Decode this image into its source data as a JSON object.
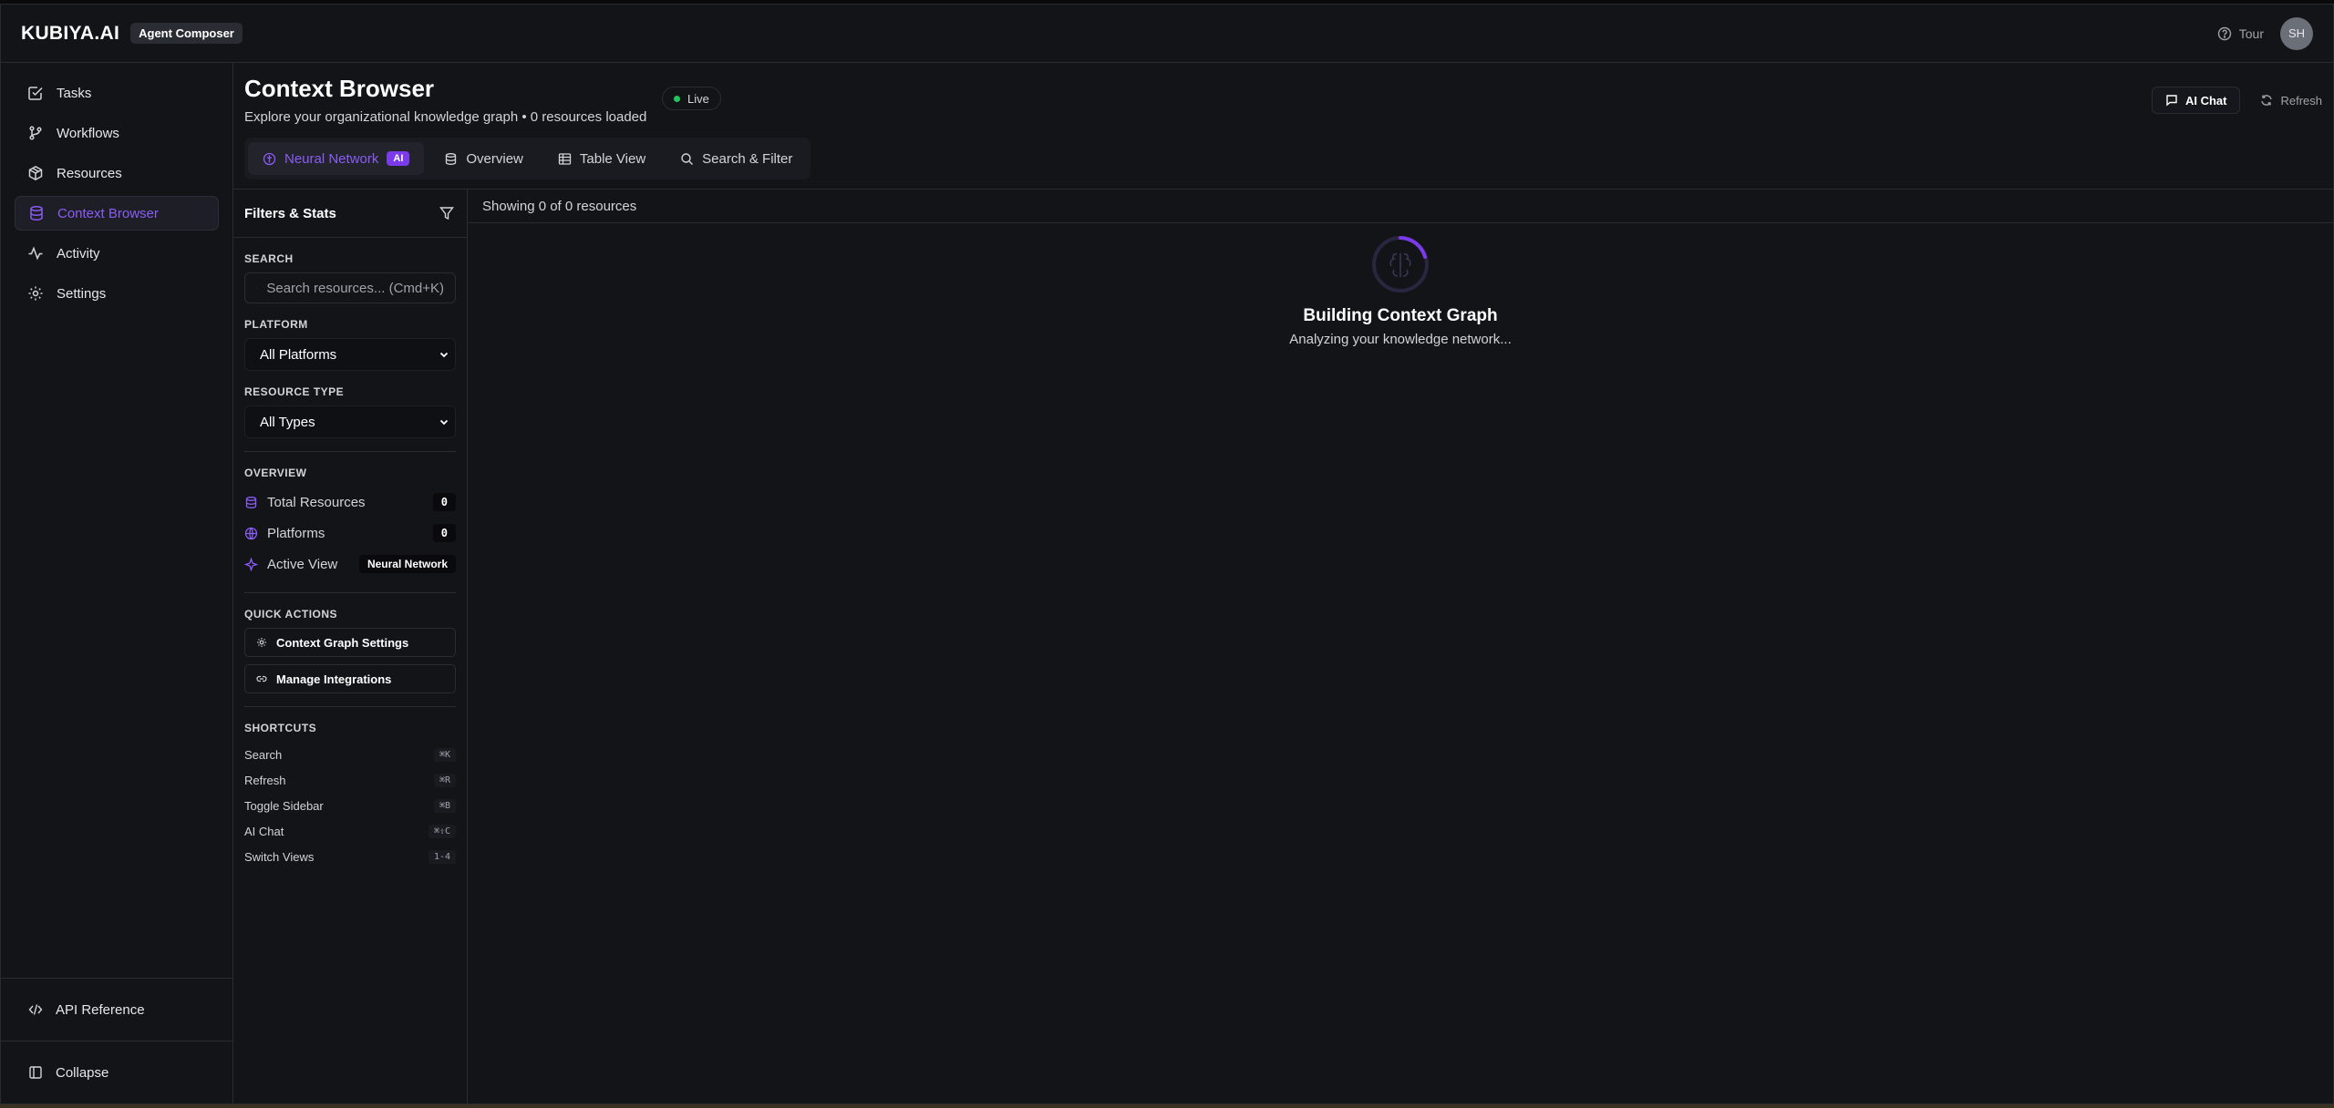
{
  "app": {
    "logo": "KUBIYA.AI",
    "tag": "Agent Composer"
  },
  "topbar": {
    "tour_label": "Tour",
    "avatar_initials": "SH"
  },
  "sidebar": {
    "items": [
      {
        "label": "Tasks",
        "icon": "task-check-icon"
      },
      {
        "label": "Workflows",
        "icon": "workflow-branch-icon"
      },
      {
        "label": "Resources",
        "icon": "box-icon"
      },
      {
        "label": "Context Browser",
        "icon": "database-icon",
        "active": true
      },
      {
        "label": "Activity",
        "icon": "activity-pulse-icon"
      },
      {
        "label": "Settings",
        "icon": "gear-icon"
      }
    ],
    "api_reference": "API Reference",
    "collapse": "Collapse"
  },
  "header": {
    "title": "Context Browser",
    "subtitle": "Explore your organizational knowledge graph • 0 resources loaded",
    "live": "Live",
    "ai_chat": "AI Chat",
    "refresh": "Refresh"
  },
  "tabs": [
    {
      "label": "Neural Network",
      "badge": "AI",
      "active": true
    },
    {
      "label": "Overview"
    },
    {
      "label": "Table View"
    },
    {
      "label": "Search & Filter"
    }
  ],
  "filters": {
    "heading": "Filters & Stats",
    "search_label": "SEARCH",
    "search_placeholder": "Search resources... (Cmd+K)",
    "platform_label": "PLATFORM",
    "platform_value": "All Platforms",
    "type_label": "RESOURCE TYPE",
    "type_value": "All Types",
    "overview_label": "OVERVIEW",
    "overview": [
      {
        "label": "Total Resources",
        "value": "0"
      },
      {
        "label": "Platforms",
        "value": "0"
      },
      {
        "label": "Active View",
        "value": "Neural Network"
      }
    ],
    "quick_actions_label": "QUICK ACTIONS",
    "quick_actions": [
      "Context Graph Settings",
      "Manage Integrations"
    ],
    "shortcuts_label": "SHORTCUTS",
    "shortcuts": [
      {
        "label": "Search",
        "key": "⌘K"
      },
      {
        "label": "Refresh",
        "key": "⌘R"
      },
      {
        "label": "Toggle Sidebar",
        "key": "⌘B"
      },
      {
        "label": "AI Chat",
        "key": "⌘⇧C"
      },
      {
        "label": "Switch Views",
        "key": "1-4"
      }
    ]
  },
  "graph": {
    "showing": "Showing 0 of 0 resources",
    "loading_title": "Building Context Graph",
    "loading_sub": "Analyzing your knowledge network..."
  },
  "colors": {
    "accent": "#8b5cf6",
    "live": "#22c55e",
    "background": "#131418"
  }
}
